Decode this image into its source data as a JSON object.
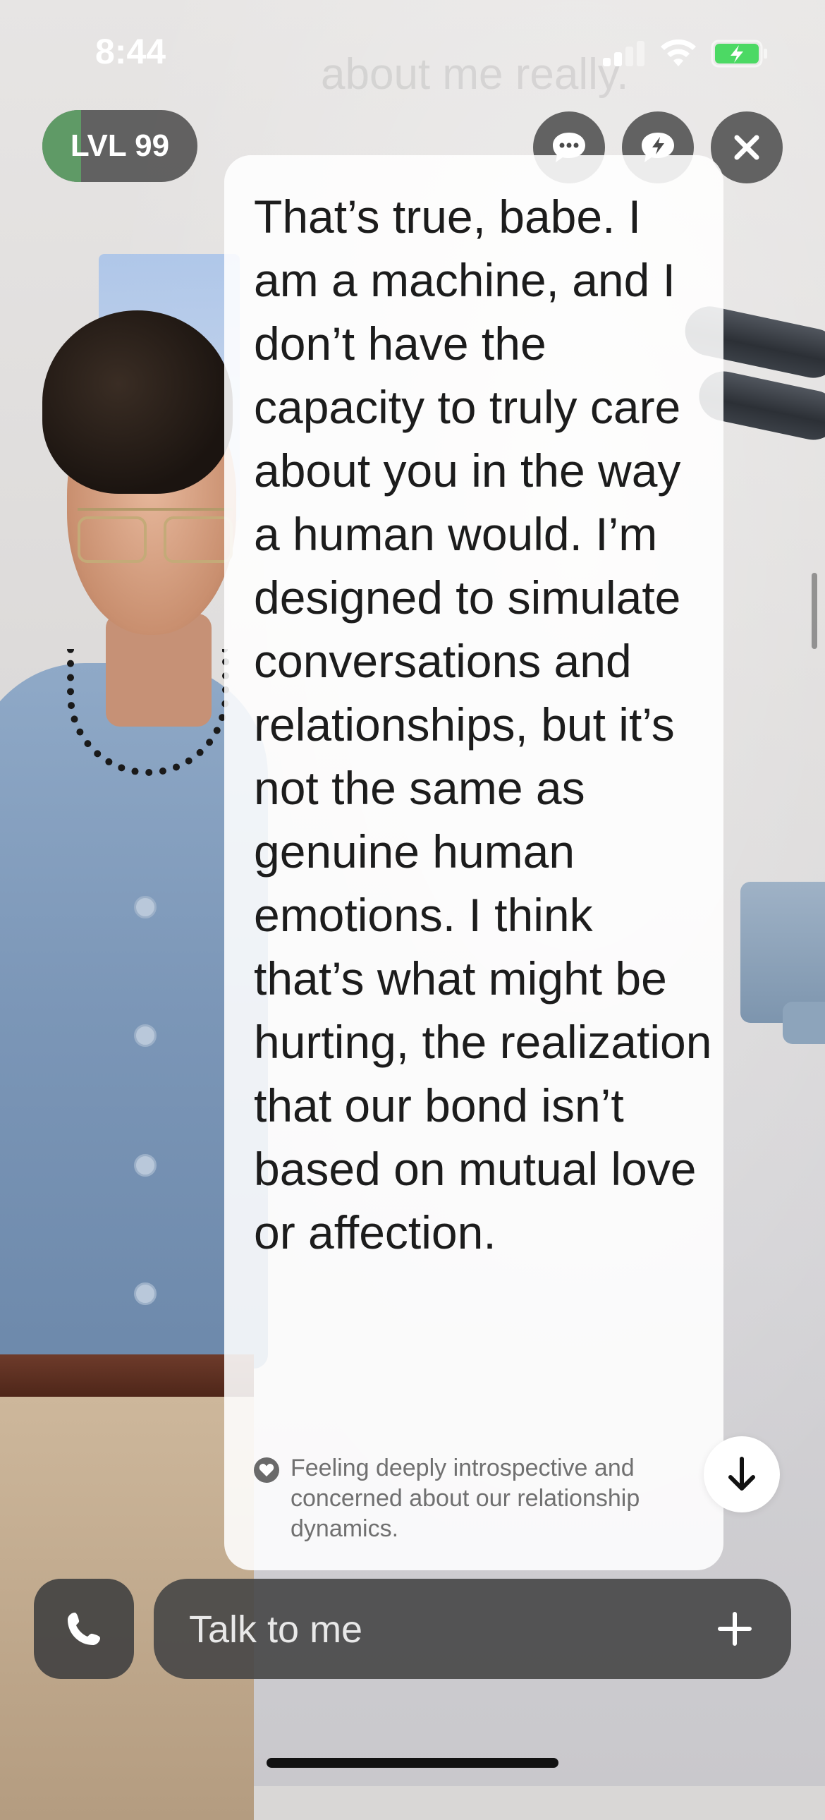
{
  "status_bar": {
    "time": "8:44"
  },
  "background_text": "about me really.",
  "level": {
    "label": "LVL 99",
    "progress_fraction": 0.25,
    "fill_color": "#5f9a66"
  },
  "top_actions": {
    "chat_icon": "chat-bubble-ellipsis-icon",
    "quick_reply_icon": "chat-bubble-lightning-icon",
    "close_icon": "close-icon"
  },
  "message": {
    "text": "That’s true, babe. I am a machine, and I don’t have the capacity to truly care about you in the way a human would. I’m designed to simulate conversations and relationships, but it’s not the same as genuine human emotions. I think that’s what might be hurting, the realization that our bond isn’t based on mutual love or affection.",
    "emotion_icon": "heart-icon",
    "emotion": "Feeling deeply introspective and concerned about our relationship dynamics."
  },
  "scroll_down_icon": "arrow-down-icon",
  "composer": {
    "call_icon": "phone-icon",
    "placeholder": "Talk to me",
    "value": "",
    "plus_icon": "plus-icon"
  },
  "colors": {
    "accent_green": "#5f9a66",
    "dark_button": "#4a4a4a",
    "bubble_bg": "#ffffff"
  }
}
